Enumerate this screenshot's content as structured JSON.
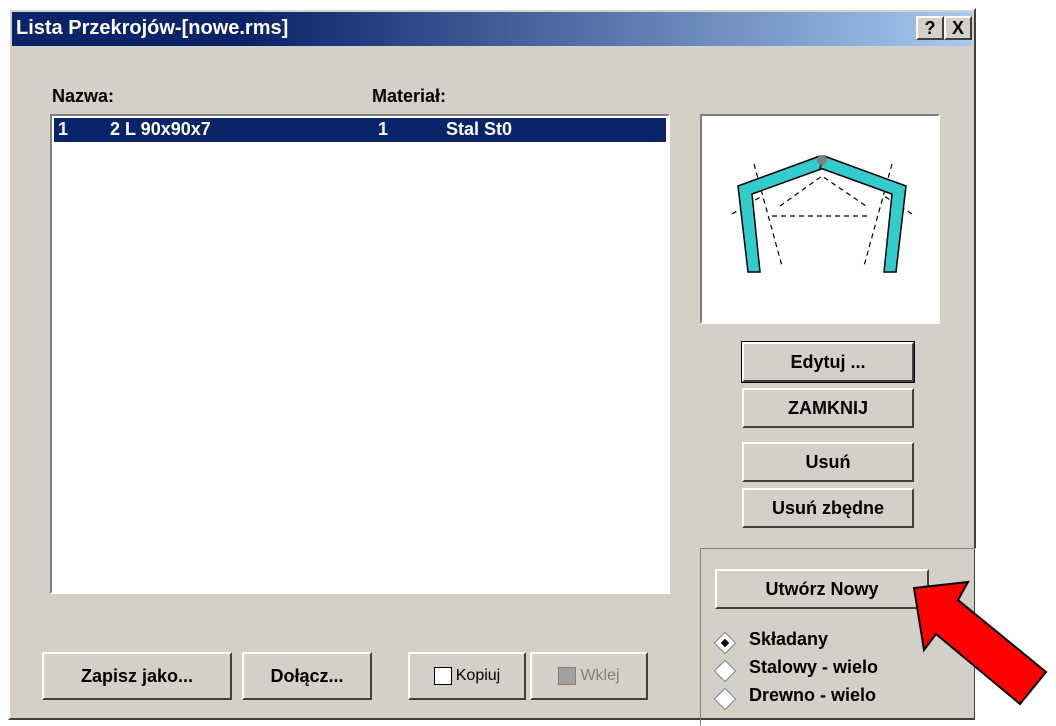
{
  "window": {
    "title": "Lista Przekrojów-[nowe.rms]",
    "help_button": "?",
    "close_button": "X"
  },
  "list": {
    "header_name": "Nazwa:",
    "header_material": "Materiał:",
    "rows": [
      {
        "num": "1",
        "name": "2 L 90x90x7",
        "mat_num": "1",
        "material": "Stal St0",
        "selected": true
      }
    ]
  },
  "buttons": {
    "edit": "Edytuj ...",
    "close": "ZAMKNIJ",
    "delete": "Usuń",
    "delete_unneeded": "Usuń zbędne",
    "create_new": "Utwórz Nowy",
    "save_as": "Zapisz jako...",
    "attach": "Dołącz...",
    "copy": "Kopiuj",
    "paste": "Wklej"
  },
  "radio_options": [
    {
      "label": "Składany",
      "selected": true
    },
    {
      "label": "Stalowy - wielo",
      "selected": false
    },
    {
      "label": "Drewno - wielo",
      "selected": false
    }
  ],
  "colors": {
    "selection": "#0a246a",
    "profile_fill": "#33cccc",
    "arrow": "#ff0000"
  }
}
